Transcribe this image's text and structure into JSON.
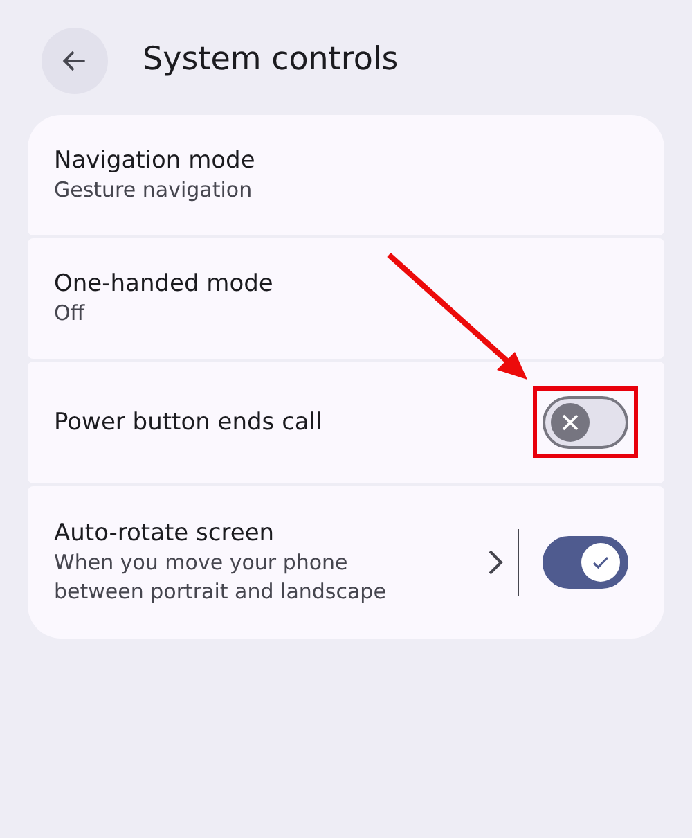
{
  "header": {
    "title": "System controls"
  },
  "items": [
    {
      "kind": "link",
      "title": "Navigation mode",
      "subtitle": "Gesture navigation"
    },
    {
      "kind": "link",
      "title": "One-handed mode",
      "subtitle": "Off"
    },
    {
      "kind": "toggle",
      "title": "Power button ends call",
      "on": false,
      "highlighted": true
    },
    {
      "kind": "split_toggle",
      "title": "Auto-rotate screen",
      "subtitle": "When you move your phone between portrait and landscape",
      "on": true,
      "highlighted": false
    }
  ],
  "annotation": {
    "kind": "arrow"
  }
}
